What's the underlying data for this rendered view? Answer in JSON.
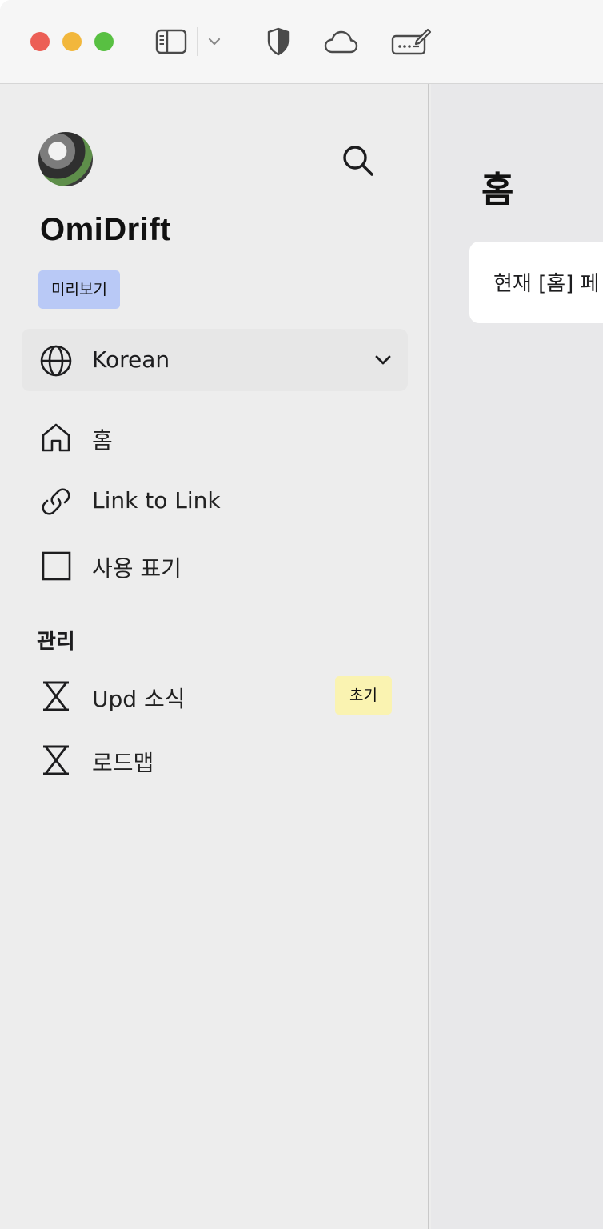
{
  "sidebar": {
    "brand": "OmiDrift",
    "preview_badge": "미리보기",
    "language": {
      "selected": "Korean",
      "icon": "globe-icon"
    },
    "nav": [
      {
        "label": "홈",
        "icon": "home-icon"
      },
      {
        "label": "Link to Link",
        "icon": "link-icon"
      },
      {
        "label": "사용 표기",
        "icon": "square-icon"
      }
    ],
    "section": "관리",
    "manage": [
      {
        "label": "Upd 소식",
        "icon": "hourglass-icon",
        "tag": "초기"
      },
      {
        "label": "로드맵",
        "icon": "hourglass-icon"
      }
    ]
  },
  "main": {
    "title": "홈",
    "card_text": "현재 [홈] 페"
  },
  "colors": {
    "preview_badge": "#b9c9f6",
    "tag_early": "#faf3b1",
    "sidebar_bg": "#ededed",
    "main_bg": "#e8e8ea"
  }
}
